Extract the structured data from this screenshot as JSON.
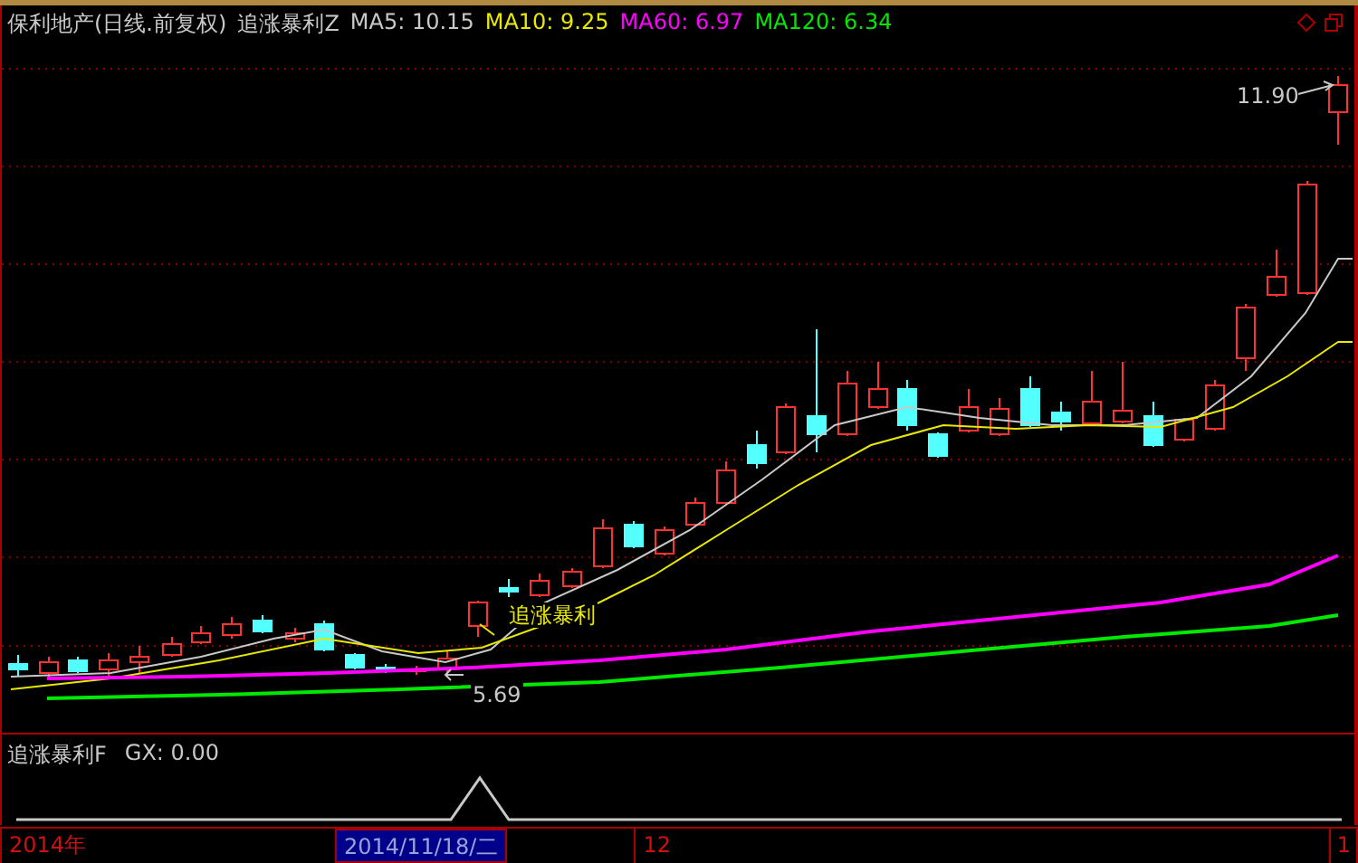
{
  "header": {
    "title": "保利地产(日线.前复权)",
    "indicator": "追涨暴利Z",
    "ma": [
      {
        "label": "MA5: 10.15",
        "color": "#c8c8c8"
      },
      {
        "label": "MA10: 9.25",
        "color": "#e8e800"
      },
      {
        "label": "MA60: 6.97",
        "color": "#ff00ff"
      },
      {
        "label": "MA120: 6.34",
        "color": "#00e800"
      }
    ]
  },
  "chart": {
    "high_label": "11.90",
    "low_label": "5.69",
    "signal_label": "追涨暴利"
  },
  "sub": {
    "title": "追涨暴利F",
    "value": "GX: 0.00"
  },
  "axis": [
    {
      "label": "2014年",
      "selected": false
    },
    {
      "label": "2014/11/18/二",
      "selected": true
    },
    {
      "label": "12",
      "selected": false
    },
    {
      "label": "1",
      "selected": false
    }
  ]
}
